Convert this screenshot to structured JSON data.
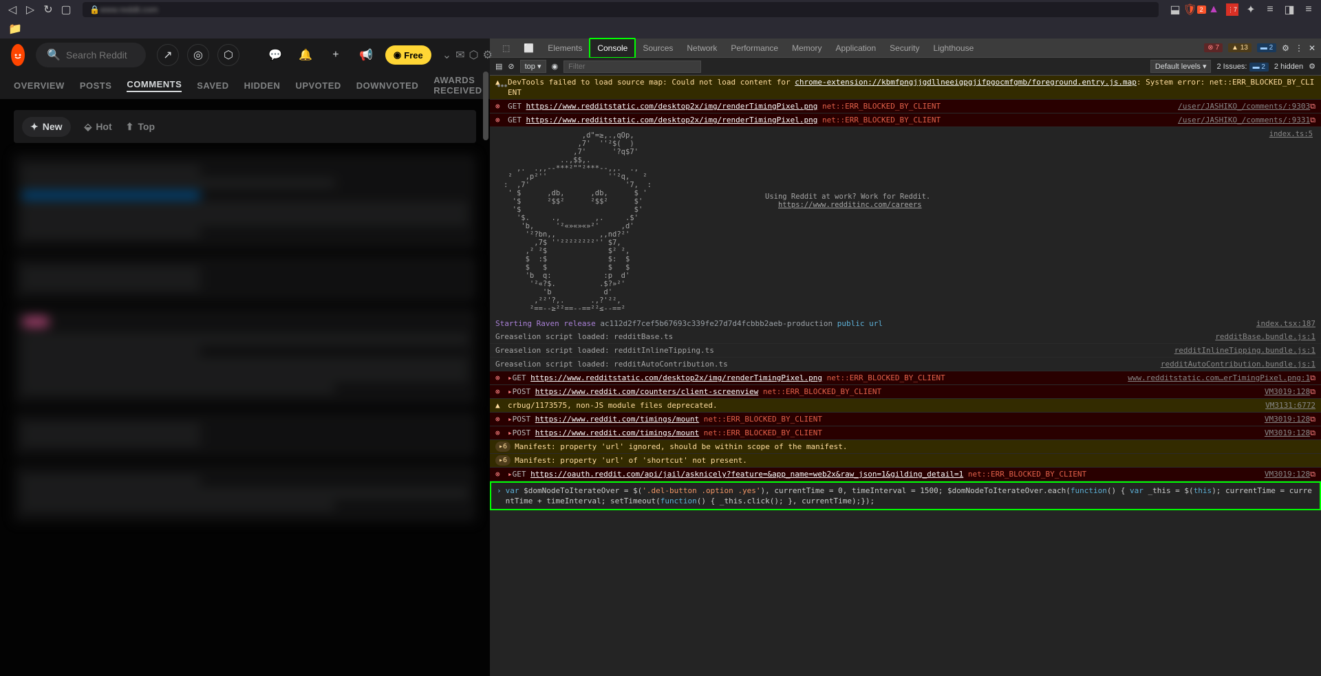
{
  "browser": {
    "address": "www.reddit.com",
    "shield_badge": "2",
    "ext_badge": "7"
  },
  "reddit": {
    "search_placeholder": "Search Reddit",
    "free_label": "Free",
    "tabs": [
      "OVERVIEW",
      "POSTS",
      "COMMENTS",
      "SAVED",
      "HIDDEN",
      "UPVOTED",
      "DOWNVOTED",
      "AWARDS RECEIVED"
    ],
    "active_tab": "COMMENTS",
    "sort": {
      "new": "New",
      "hot": "Hot",
      "top": "Top"
    }
  },
  "devtools": {
    "tabs": [
      "Elements",
      "Console",
      "Sources",
      "Network",
      "Performance",
      "Memory",
      "Application",
      "Security",
      "Lighthouse"
    ],
    "active": "Console",
    "err_count": "7",
    "warn_count": "13",
    "msg_count": "2",
    "filter_top": "top",
    "filter_placeholder": "Filter",
    "default_levels": "Default levels",
    "issues_label": "2 Issues:",
    "issues_num": "2",
    "hidden_label": "2 hidden",
    "logs": {
      "warn1a": "DevTools failed to load source map: Could not load content for ",
      "warn1b": "chrome-extension://kbmfpngjjgdllneeigpgjifpgocmfgmb/foreground.entry.js.map",
      "warn1c": ": System error: net::ERR_BLOCKED_BY_CLIENT",
      "get": "GET",
      "post": "POST",
      "url_pixel": "https://www.redditstatic.com/desktop2x/img/renderTimingPixel.png",
      "err_blocked": " net::ERR_BLOCKED_BY_CLIENT",
      "src_user1": "/user/JASHIKO_/comments/:9303",
      "src_user2": "/user/JASHIKO_/comments/:9331",
      "idx_ts": "index.ts:5",
      "hire_text": "Using Reddit at work? Work for Reddit.",
      "hire_link": "https://www.redditinc.com/careers",
      "raven1": "Starting Raven release ",
      "raven2": "ac112d2f7cef5b67693c339fe27d7d4fcbbb2aeb-production",
      "raven3": " public url",
      "raven_src": "index.tsx:187",
      "grease1": "Greaselion script loaded: redditBase.ts",
      "grease1_src": "redditBase.bundle.js:1",
      "grease2": "Greaselion script loaded: redditInlineTipping.ts",
      "grease2_src": "redditInlineTipping.bundle.js:1",
      "grease3": "Greaselion script loaded: redditAutoContribution.ts",
      "grease3_src": "redditAutoContribution.bundle.js:1",
      "pixel_src": "www.redditstatic.com…erTimingPixel.png:1",
      "counters_url": "https://www.reddit.com/counters/client-screenview",
      "vm3019": "VM3019:128",
      "crbug": "crbug/1173575, non-JS module files deprecated.",
      "vm3131": "VM3131:6772",
      "timings_url": "https://www.reddit.com/timings/mount",
      "manifest1": "Manifest: property 'url' ignored, should be within scope of the manifest.",
      "manifest2": "Manifest: property 'url' of 'shortcut' not present.",
      "oauth_url": "https://oauth.reddit.com/api/jail/asknicely?feature=&app_name=web2x&raw_json=1&gilding_detail=1",
      "badge6": "6",
      "input_code": "var $domNodeToIterateOver = $('.del-button .option .yes'),  currentTime = 0,    timeInterval = 1500; $domNodeToIterateOver.each(function() {   var _this = $(this);  currentTime = currentTime + timeInterval;  setTimeout(function() {  _this.click();  }, currentTime);});"
    }
  },
  "ascii": "                  ,d\"=≥,.,qOp,\n                 ,7'  ''²$(  )\n                ,7'      '?q$7'\n             ..,$$,.\n   ,.  .,,--***²\"\"²***--,,.  .,\n ²   ,p²''              ''²q,   ²\n:  ,7'                      '7,  :\n ' $      ,db,      ,db,      $ '\n  '$      ²$$²      ²$$²      $'\n  '$                          $'\n   '$.     .,        ,.     .$'\n    'b,     '²«»«»«»²'     ,d'\n     '²?bn,,          ,,nd?²'\n       ,7$ ''²²²²²²²²'' $7,\n     ,² ²$              $² ²,\n     $  :$              $:  $\n     $   $              $   $\n     'b  q:            :p  d'\n      '²«?$.          .$?»²'\n         'b            d'\n       ,²²'?,.      .,?'²²,\n      ²==--≥²²==--==²²≤--==²"
}
